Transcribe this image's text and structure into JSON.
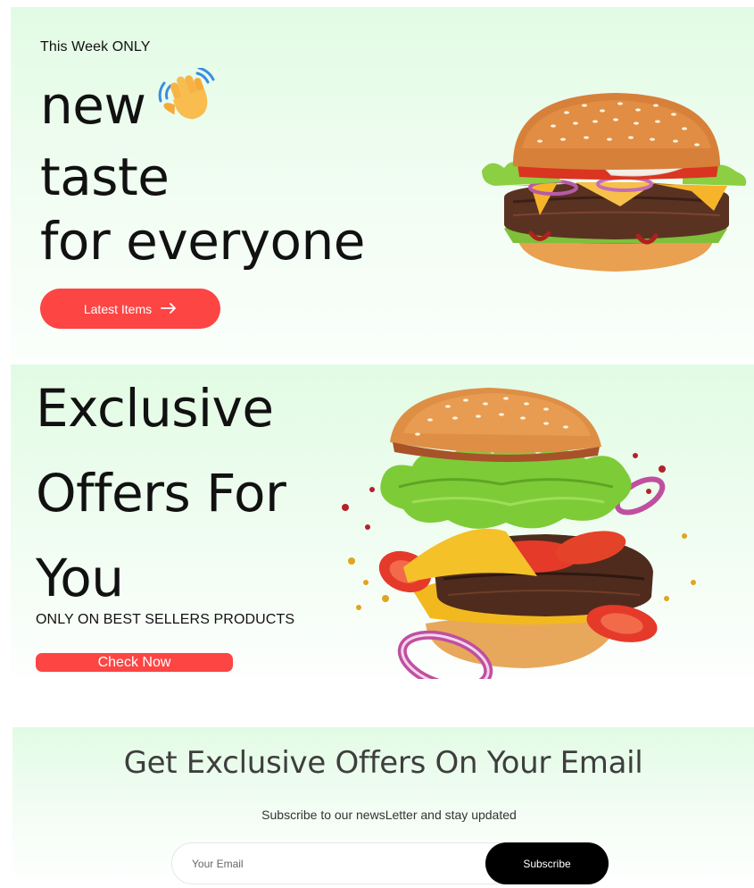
{
  "hero": {
    "kicker": "This Week ONLY",
    "headline_lines": [
      "new",
      "taste",
      "for everyone"
    ],
    "wave_icon": "waving-hand-icon",
    "cta_label": "Latest Items",
    "cta_icon": "arrow-right-icon",
    "image": "burger-image"
  },
  "offer": {
    "title_lines": [
      "Exclusive",
      "Offers For",
      "You"
    ],
    "subtitle": "ONLY ON BEST SELLERS PRODUCTS",
    "cta_label": "Check Now",
    "image": "exploded-burger-image"
  },
  "newsletter": {
    "title": "Get Exclusive Offers On Your Email",
    "subtitle": "Subscribe to our newsLetter and stay updated",
    "email_placeholder": "Your Email",
    "email_value": "",
    "subscribe_label": "Subscribe"
  },
  "colors": {
    "accent": "#fd4544",
    "section_bg": "#e2fbe4",
    "text": "#111111",
    "button_dark": "#000000"
  }
}
